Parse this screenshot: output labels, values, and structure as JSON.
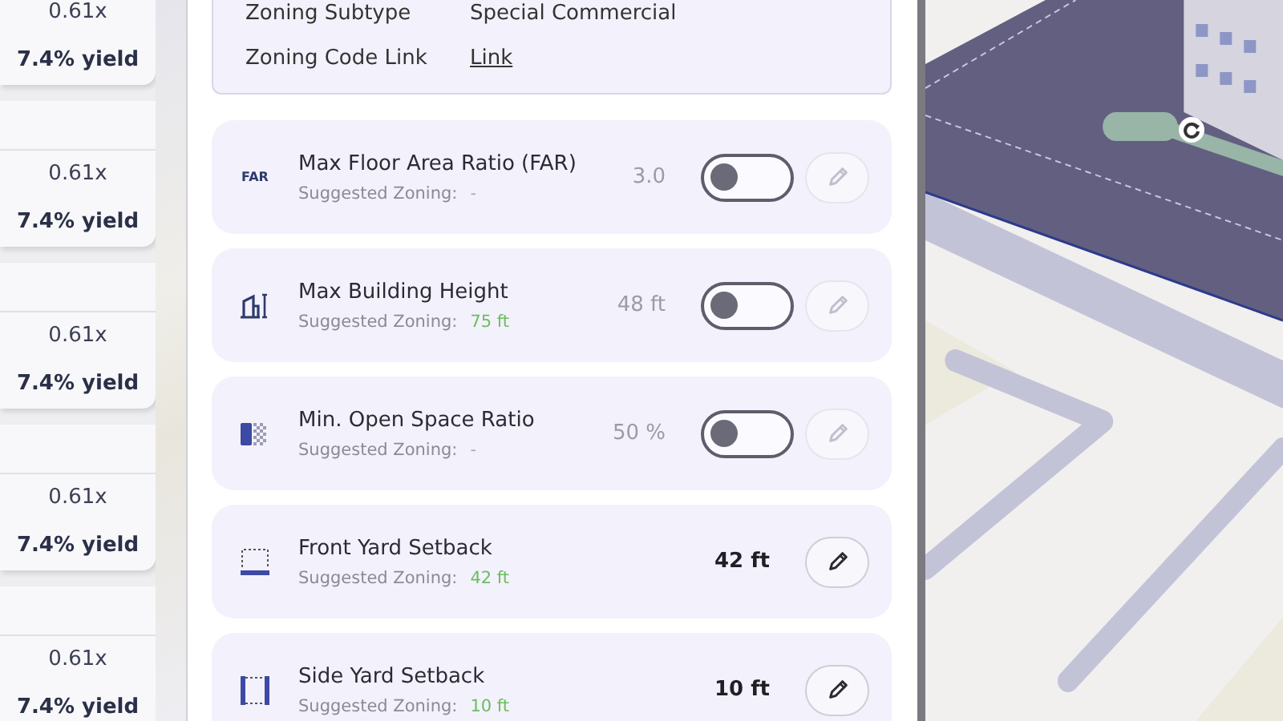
{
  "results": [
    {
      "multiple": "0.61x",
      "yield": "7.4% yield"
    },
    {
      "multiple": "0.61x",
      "yield": "7.4% yield"
    },
    {
      "multiple": "0.61x",
      "yield": "7.4% yield"
    },
    {
      "multiple": "0.61x",
      "yield": "7.4% yield"
    },
    {
      "multiple": "0.61x",
      "yield": "7.4% yield"
    }
  ],
  "zoning_info": [
    {
      "label": "Zoning Subtype",
      "value": "Special Commercial",
      "kind": "text"
    },
    {
      "label": "Zoning Code Link",
      "value": "Link",
      "kind": "link"
    }
  ],
  "metrics": [
    {
      "kind": "toggle",
      "icon_text": "FAR",
      "title": "Max Floor Area Ratio (FAR)",
      "suggested_label": "Suggested Zoning:",
      "suggested": "-",
      "suggested_available": false,
      "value": "3.0",
      "on": false,
      "edit_disabled": true
    },
    {
      "kind": "toggle",
      "title": "Max Building Height",
      "suggested_label": "Suggested Zoning:",
      "suggested": "75 ft",
      "suggested_available": true,
      "value": "48 ft",
      "on": false,
      "edit_disabled": true
    },
    {
      "kind": "toggle",
      "title": "Min. Open Space Ratio",
      "suggested_label": "Suggested Zoning:",
      "suggested": "-",
      "suggested_available": false,
      "value": "50 %",
      "on": false,
      "edit_disabled": true
    },
    {
      "kind": "plain",
      "title": "Front Yard Setback",
      "suggested_label": "Suggested Zoning:",
      "suggested": "42 ft",
      "suggested_available": true,
      "value": "42 ft",
      "edit_disabled": false
    },
    {
      "kind": "plain",
      "title": "Side Yard Setback",
      "suggested_label": "Suggested Zoning:",
      "suggested": "10 ft",
      "suggested_available": true,
      "value": "10 ft",
      "edit_disabled": false
    }
  ]
}
